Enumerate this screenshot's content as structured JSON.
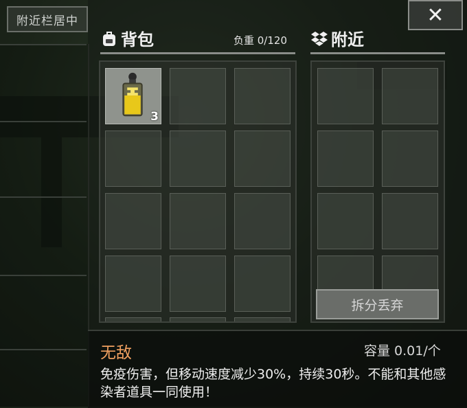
{
  "sidebar": {
    "toggle_label": "附近栏居中"
  },
  "backpack": {
    "title": "背包",
    "weight_text": "负重 0/120"
  },
  "nearby": {
    "title": "附近"
  },
  "slots": {
    "first_item_count": "3"
  },
  "actions": {
    "split_drop_label": "拆分丢弃",
    "close_label": "✕"
  },
  "item": {
    "name": "无敌",
    "capacity_text": "容量 0.01/个",
    "description": "免疫伤害，但移动速度减少30%，持续30秒。不能和其他感染者道具一同使用！"
  },
  "colors": {
    "item_name": "#f0a060",
    "slot_filled": "#8f938d",
    "potion_yellow": "#e8c81a"
  },
  "icons": {
    "backpack": "backpack-icon",
    "nearby": "dropbox-icon",
    "close": "close-icon"
  }
}
